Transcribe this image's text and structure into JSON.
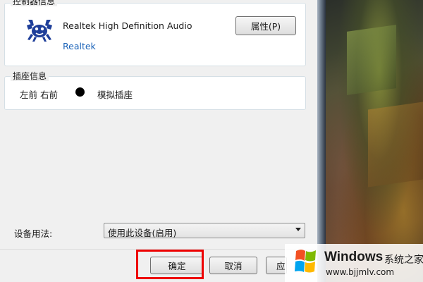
{
  "controller_group": {
    "title": "控制器信息",
    "device_name": "Realtek High Definition Audio",
    "vendor": "Realtek",
    "properties_button": "属性(P)",
    "logo_icon": "realtek-crab-icon"
  },
  "jack_group": {
    "title": "插座信息",
    "location": "左前 右前",
    "type": "模拟插座",
    "jack_color": "#000000"
  },
  "device_usage": {
    "label": "设备用法:",
    "selected": "使用此设备(启用)"
  },
  "footer": {
    "ok_label": "确定",
    "cancel_label": "取消",
    "apply_label": "应"
  },
  "watermark": {
    "title": "Windows",
    "subtitle": "系统之家",
    "url": "www.bjjmlv.com"
  },
  "colors": {
    "highlight": "#ee0000",
    "link": "#1c64b9"
  }
}
